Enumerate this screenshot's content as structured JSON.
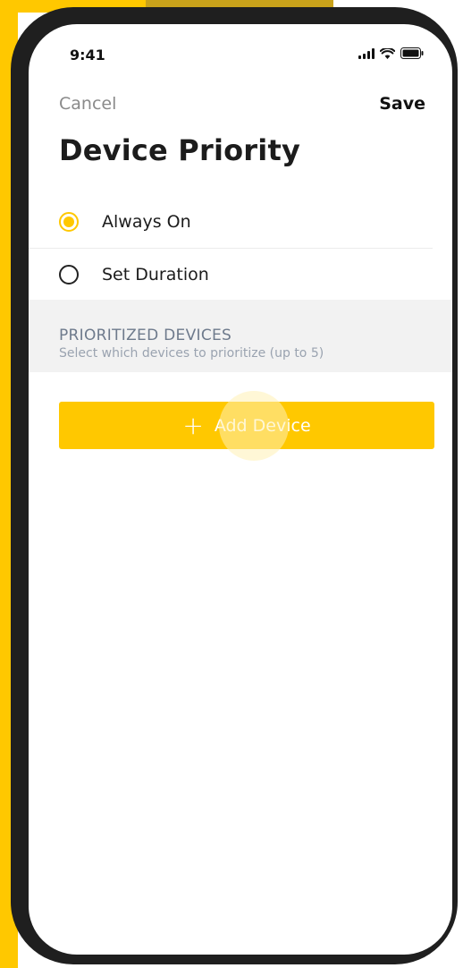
{
  "status_bar": {
    "time": "9:41"
  },
  "nav": {
    "cancel_label": "Cancel",
    "save_label": "Save"
  },
  "page_title": "Device Priority",
  "options": [
    {
      "label": "Always On",
      "selected": true
    },
    {
      "label": "Set Duration",
      "selected": false
    }
  ],
  "section": {
    "title": "PRIORITIZED DEVICES",
    "subtitle": "Select which devices to prioritize (up to 5)"
  },
  "add_button": {
    "label": "Add Device",
    "icon": "plus-icon"
  },
  "colors": {
    "accent": "#ffc800",
    "section_title": "#6e7a8c",
    "section_bg": "#f2f2f2"
  }
}
